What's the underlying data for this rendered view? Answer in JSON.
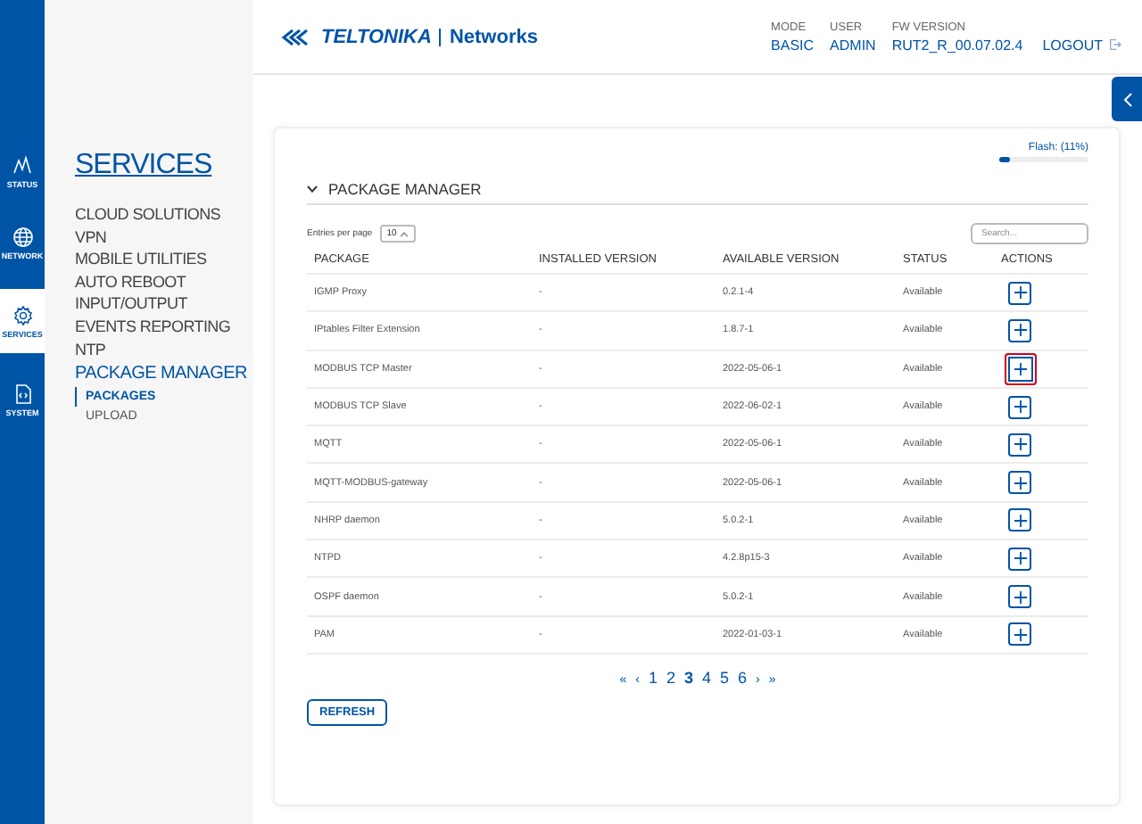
{
  "rail": [
    {
      "label": "STATUS",
      "selected": false
    },
    {
      "label": "NETWORK",
      "selected": false
    },
    {
      "label": "SERVICES",
      "selected": true
    },
    {
      "label": "SYSTEM",
      "selected": false
    }
  ],
  "submenu": {
    "title": "SERVICES",
    "items": [
      {
        "label": "CLOUD SOLUTIONS",
        "selected": false
      },
      {
        "label": "VPN",
        "selected": false
      },
      {
        "label": "MOBILE UTILITIES",
        "selected": false
      },
      {
        "label": "AUTO REBOOT",
        "selected": false
      },
      {
        "label": "INPUT/OUTPUT",
        "selected": false
      },
      {
        "label": "EVENTS REPORTING",
        "selected": false
      },
      {
        "label": "NTP",
        "selected": false
      },
      {
        "label": "PACKAGE MANAGER",
        "selected": true,
        "children": [
          {
            "label": "PACKAGES",
            "selected": true
          },
          {
            "label": "UPLOAD",
            "selected": false
          }
        ]
      }
    ]
  },
  "header": {
    "logo": "TELTONIKA",
    "logo_suffix": "Networks",
    "info": [
      {
        "label": "MODE",
        "value": "BASIC"
      },
      {
        "label": "USER",
        "value": "ADMIN"
      },
      {
        "label": "FW VERSION",
        "value": "RUT2_R_00.07.02.4"
      }
    ],
    "logout": "LOGOUT"
  },
  "flash": {
    "label": "Flash: (11%)",
    "level": 0.11
  },
  "section": {
    "title": "PACKAGE MANAGER",
    "expanded": true
  },
  "entries": {
    "label": "Entries per page",
    "value": "10"
  },
  "search": {
    "placeholder": "Search..."
  },
  "table": {
    "columns": [
      "PACKAGE",
      "INSTALLED VERSION",
      "AVAILABLE VERSION",
      "STATUS",
      "ACTIONS"
    ],
    "rows": [
      {
        "package": "IGMP Proxy",
        "installed": "-",
        "available": "0.2.1-4",
        "status": "Available",
        "highlighted": false
      },
      {
        "package": "IPtables Filter Extension",
        "installed": "-",
        "available": "1.8.7-1",
        "status": "Available",
        "highlighted": false
      },
      {
        "package": "MODBUS TCP Master",
        "installed": "-",
        "available": "2022-05-06-1",
        "status": "Available",
        "highlighted": true
      },
      {
        "package": "MODBUS TCP Slave",
        "installed": "-",
        "available": "2022-06-02-1",
        "status": "Available",
        "highlighted": false
      },
      {
        "package": "MQTT",
        "installed": "-",
        "available": "2022-05-06-1",
        "status": "Available",
        "highlighted": false
      },
      {
        "package": "MQTT-MODBUS-gateway",
        "installed": "-",
        "available": "2022-05-06-1",
        "status": "Available",
        "highlighted": false
      },
      {
        "package": "NHRP daemon",
        "installed": "-",
        "available": "5.0.2-1",
        "status": "Available",
        "highlighted": false
      },
      {
        "package": "NTPD",
        "installed": "-",
        "available": "4.2.8p15-3",
        "status": "Available",
        "highlighted": false
      },
      {
        "package": "OSPF daemon",
        "installed": "-",
        "available": "5.0.2-1",
        "status": "Available",
        "highlighted": false
      },
      {
        "package": "PAM",
        "installed": "-",
        "available": "2022-01-03-1",
        "status": "Available",
        "highlighted": false
      }
    ]
  },
  "pagination": {
    "first": "«",
    "prev": "‹",
    "pages": [
      {
        "label": "1",
        "selected": false
      },
      {
        "label": "2",
        "selected": false
      },
      {
        "label": "3",
        "selected": true
      },
      {
        "label": "4",
        "selected": false
      },
      {
        "label": "5",
        "selected": false
      },
      {
        "label": "6",
        "selected": false
      }
    ],
    "next": "›",
    "last": "»"
  },
  "refresh_button": "REFRESH"
}
